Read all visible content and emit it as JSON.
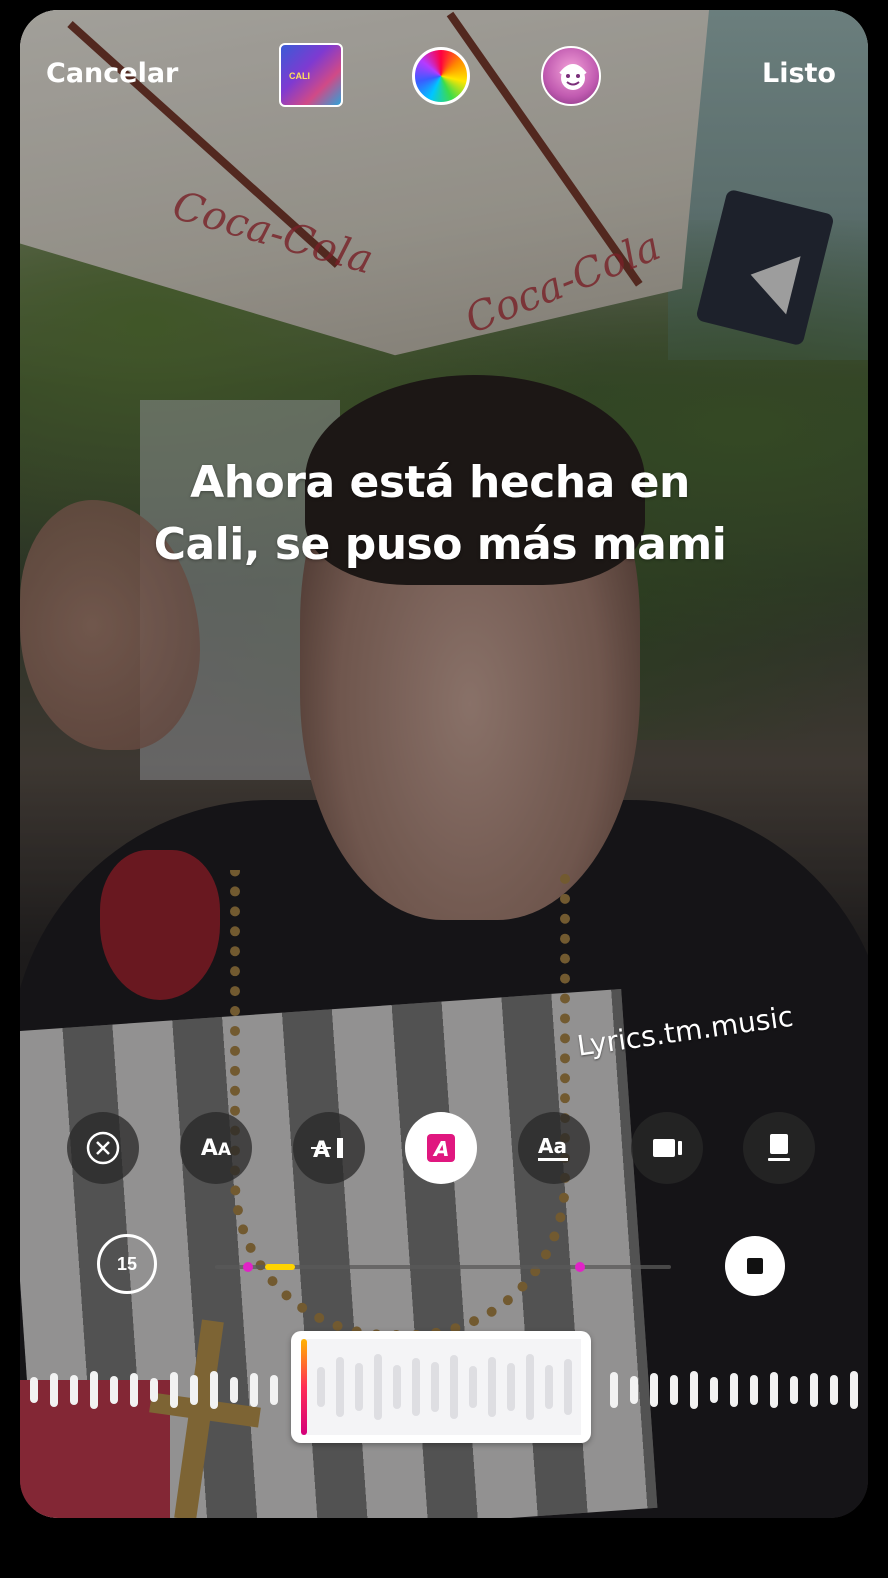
{
  "top_bar": {
    "cancel_label": "Cancelar",
    "done_label": "Listo",
    "album_icon": "album-art",
    "color_icon": "color-wheel-icon",
    "sticker_icon": "face-sticker-icon"
  },
  "lyrics_text": "Ahora está hecha en Cali, se puso más mami",
  "watermark": "Lyrics.tm.music",
  "styles": {
    "selected_index": 3,
    "items": [
      "close-icon",
      "text-style-aa-icon",
      "text-cursor-icon",
      "text-highlight-icon",
      "text-underline-icon",
      "video-clip-icon",
      "card-icon"
    ]
  },
  "playback": {
    "duration_label": "15",
    "progress_fraction": 0.14
  },
  "colors": {
    "accent_magenta": "#e023c6",
    "accent_yellow": "#ffd400",
    "active_style": "#e0177f"
  }
}
